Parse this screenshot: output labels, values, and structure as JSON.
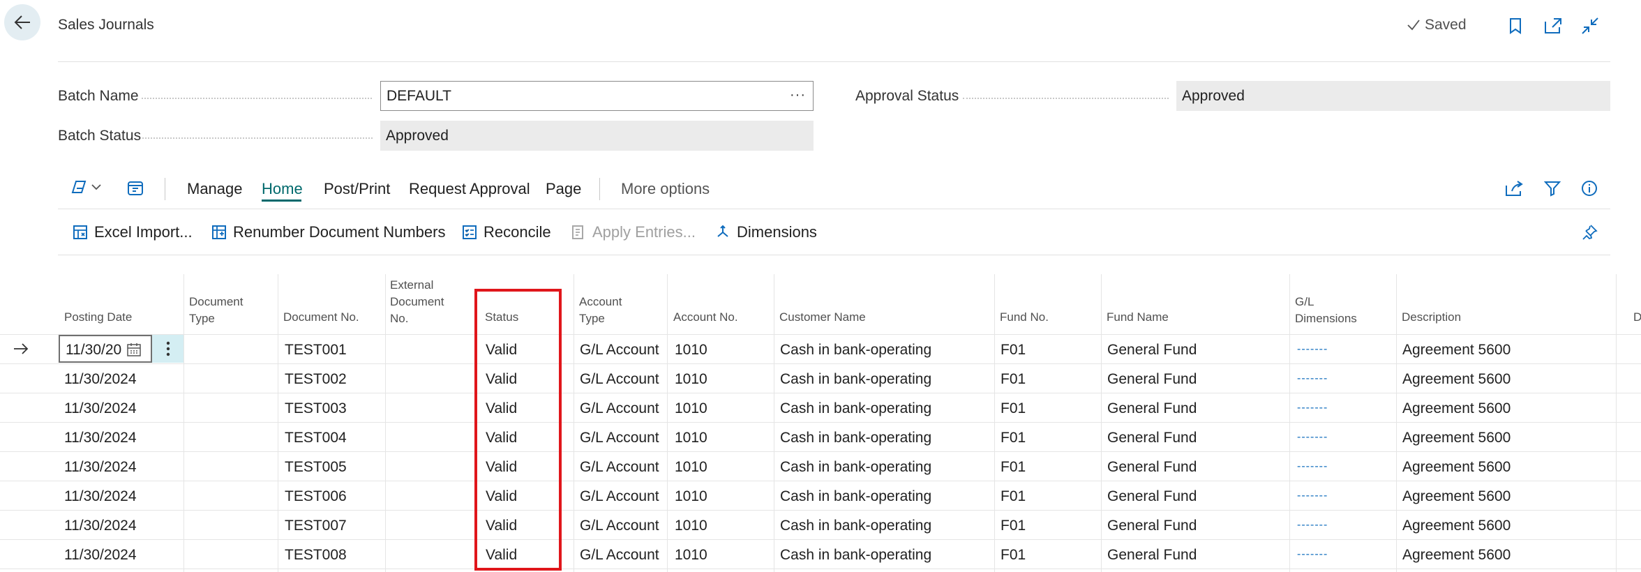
{
  "header": {
    "title": "Sales Journals",
    "saved_label": "Saved"
  },
  "fields": {
    "batch_name_label": "Batch Name",
    "batch_name_value": "DEFAULT",
    "batch_status_label": "Batch Status",
    "batch_status_value": "Approved",
    "approval_status_label": "Approval Status",
    "approval_status_value": "Approved"
  },
  "menu": {
    "manage": "Manage",
    "home": "Home",
    "post_print": "Post/Print",
    "request_approval": "Request Approval",
    "page": "Page",
    "more_options": "More options"
  },
  "actions": {
    "excel_import": "Excel Import...",
    "renumber": "Renumber Document Numbers",
    "reconcile": "Reconcile",
    "apply_entries": "Apply Entries...",
    "dimensions": "Dimensions"
  },
  "columns": {
    "posting_date": "Posting Date",
    "document_type_1": "Document",
    "document_type_2": "Type",
    "document_no": "Document No.",
    "ext_doc_1": "External",
    "ext_doc_2": "Document",
    "ext_doc_3": "No.",
    "status": "Status",
    "account_type_1": "Account",
    "account_type_2": "Type",
    "account_no": "Account No.",
    "customer_name": "Customer Name",
    "fund_no": "Fund No.",
    "fund_name": "Fund Name",
    "gl_dim_1": "G/L",
    "gl_dim_2": "Dimensions",
    "description": "Description",
    "cut_off": "D"
  },
  "rows": [
    {
      "posting_date": "11/30/20",
      "document_no": "TEST001",
      "status": "Valid",
      "account_type": "G/L Account",
      "account_no": "1010",
      "customer_name": "Cash in bank-operating",
      "fund_no": "F01",
      "fund_name": "General Fund",
      "gl_dimensions": "-------",
      "description": "Agreement 5600"
    },
    {
      "posting_date": "11/30/2024",
      "document_no": "TEST002",
      "status": "Valid",
      "account_type": "G/L Account",
      "account_no": "1010",
      "customer_name": "Cash in bank-operating",
      "fund_no": "F01",
      "fund_name": "General Fund",
      "gl_dimensions": "-------",
      "description": "Agreement 5600"
    },
    {
      "posting_date": "11/30/2024",
      "document_no": "TEST003",
      "status": "Valid",
      "account_type": "G/L Account",
      "account_no": "1010",
      "customer_name": "Cash in bank-operating",
      "fund_no": "F01",
      "fund_name": "General Fund",
      "gl_dimensions": "-------",
      "description": "Agreement 5600"
    },
    {
      "posting_date": "11/30/2024",
      "document_no": "TEST004",
      "status": "Valid",
      "account_type": "G/L Account",
      "account_no": "1010",
      "customer_name": "Cash in bank-operating",
      "fund_no": "F01",
      "fund_name": "General Fund",
      "gl_dimensions": "-------",
      "description": "Agreement 5600"
    },
    {
      "posting_date": "11/30/2024",
      "document_no": "TEST005",
      "status": "Valid",
      "account_type": "G/L Account",
      "account_no": "1010",
      "customer_name": "Cash in bank-operating",
      "fund_no": "F01",
      "fund_name": "General Fund",
      "gl_dimensions": "-------",
      "description": "Agreement 5600"
    },
    {
      "posting_date": "11/30/2024",
      "document_no": "TEST006",
      "status": "Valid",
      "account_type": "G/L Account",
      "account_no": "1010",
      "customer_name": "Cash in bank-operating",
      "fund_no": "F01",
      "fund_name": "General Fund",
      "gl_dimensions": "-------",
      "description": "Agreement 5600"
    },
    {
      "posting_date": "11/30/2024",
      "document_no": "TEST007",
      "status": "Valid",
      "account_type": "G/L Account",
      "account_no": "1010",
      "customer_name": "Cash in bank-operating",
      "fund_no": "F01",
      "fund_name": "General Fund",
      "gl_dimensions": "-------",
      "description": "Agreement 5600"
    },
    {
      "posting_date": "11/30/2024",
      "document_no": "TEST008",
      "status": "Valid",
      "account_type": "G/L Account",
      "account_no": "1010",
      "customer_name": "Cash in bank-operating",
      "fund_no": "F01",
      "fund_name": "General Fund",
      "gl_dimensions": "-------",
      "description": "Agreement 5600"
    }
  ]
}
